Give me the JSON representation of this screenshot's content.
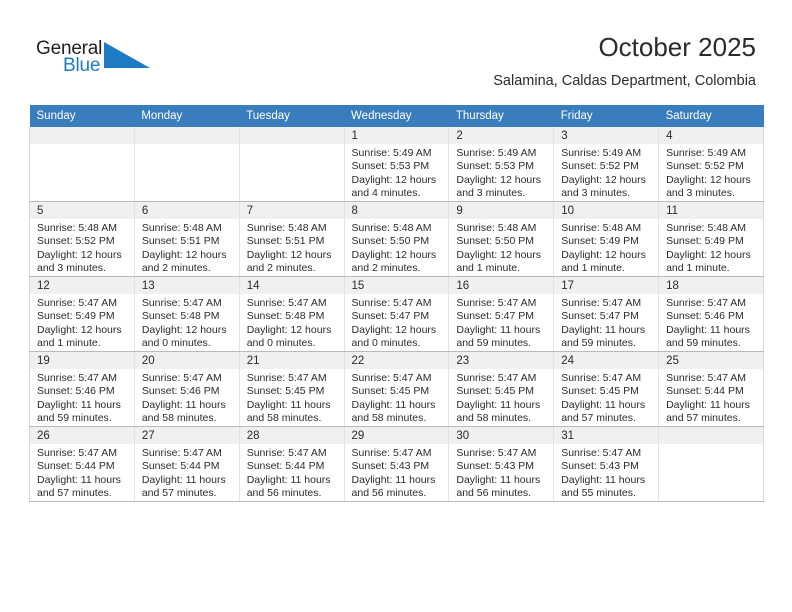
{
  "brand": {
    "name_part1": "General",
    "name_part2": "Blue",
    "triangle_icon": "triangle-icon",
    "accent_color": "#1f7ac4"
  },
  "header": {
    "title": "October 2025",
    "subtitle": "Salamina, Caldas Department, Colombia"
  },
  "calendar": {
    "header_bg": "#3a7dbf",
    "daynum_bg": "#f0f0f0",
    "columns": [
      "Sunday",
      "Monday",
      "Tuesday",
      "Wednesday",
      "Thursday",
      "Friday",
      "Saturday"
    ],
    "weeks": [
      [
        {
          "day": "",
          "lines": []
        },
        {
          "day": "",
          "lines": []
        },
        {
          "day": "",
          "lines": []
        },
        {
          "day": "1",
          "lines": [
            "Sunrise: 5:49 AM",
            "Sunset: 5:53 PM",
            "Daylight: 12 hours",
            "and 4 minutes."
          ]
        },
        {
          "day": "2",
          "lines": [
            "Sunrise: 5:49 AM",
            "Sunset: 5:53 PM",
            "Daylight: 12 hours",
            "and 3 minutes."
          ]
        },
        {
          "day": "3",
          "lines": [
            "Sunrise: 5:49 AM",
            "Sunset: 5:52 PM",
            "Daylight: 12 hours",
            "and 3 minutes."
          ]
        },
        {
          "day": "4",
          "lines": [
            "Sunrise: 5:49 AM",
            "Sunset: 5:52 PM",
            "Daylight: 12 hours",
            "and 3 minutes."
          ]
        }
      ],
      [
        {
          "day": "5",
          "lines": [
            "Sunrise: 5:48 AM",
            "Sunset: 5:52 PM",
            "Daylight: 12 hours",
            "and 3 minutes."
          ]
        },
        {
          "day": "6",
          "lines": [
            "Sunrise: 5:48 AM",
            "Sunset: 5:51 PM",
            "Daylight: 12 hours",
            "and 2 minutes."
          ]
        },
        {
          "day": "7",
          "lines": [
            "Sunrise: 5:48 AM",
            "Sunset: 5:51 PM",
            "Daylight: 12 hours",
            "and 2 minutes."
          ]
        },
        {
          "day": "8",
          "lines": [
            "Sunrise: 5:48 AM",
            "Sunset: 5:50 PM",
            "Daylight: 12 hours",
            "and 2 minutes."
          ]
        },
        {
          "day": "9",
          "lines": [
            "Sunrise: 5:48 AM",
            "Sunset: 5:50 PM",
            "Daylight: 12 hours",
            "and 1 minute."
          ]
        },
        {
          "day": "10",
          "lines": [
            "Sunrise: 5:48 AM",
            "Sunset: 5:49 PM",
            "Daylight: 12 hours",
            "and 1 minute."
          ]
        },
        {
          "day": "11",
          "lines": [
            "Sunrise: 5:48 AM",
            "Sunset: 5:49 PM",
            "Daylight: 12 hours",
            "and 1 minute."
          ]
        }
      ],
      [
        {
          "day": "12",
          "lines": [
            "Sunrise: 5:47 AM",
            "Sunset: 5:49 PM",
            "Daylight: 12 hours",
            "and 1 minute."
          ]
        },
        {
          "day": "13",
          "lines": [
            "Sunrise: 5:47 AM",
            "Sunset: 5:48 PM",
            "Daylight: 12 hours",
            "and 0 minutes."
          ]
        },
        {
          "day": "14",
          "lines": [
            "Sunrise: 5:47 AM",
            "Sunset: 5:48 PM",
            "Daylight: 12 hours",
            "and 0 minutes."
          ]
        },
        {
          "day": "15",
          "lines": [
            "Sunrise: 5:47 AM",
            "Sunset: 5:47 PM",
            "Daylight: 12 hours",
            "and 0 minutes."
          ]
        },
        {
          "day": "16",
          "lines": [
            "Sunrise: 5:47 AM",
            "Sunset: 5:47 PM",
            "Daylight: 11 hours",
            "and 59 minutes."
          ]
        },
        {
          "day": "17",
          "lines": [
            "Sunrise: 5:47 AM",
            "Sunset: 5:47 PM",
            "Daylight: 11 hours",
            "and 59 minutes."
          ]
        },
        {
          "day": "18",
          "lines": [
            "Sunrise: 5:47 AM",
            "Sunset: 5:46 PM",
            "Daylight: 11 hours",
            "and 59 minutes."
          ]
        }
      ],
      [
        {
          "day": "19",
          "lines": [
            "Sunrise: 5:47 AM",
            "Sunset: 5:46 PM",
            "Daylight: 11 hours",
            "and 59 minutes."
          ]
        },
        {
          "day": "20",
          "lines": [
            "Sunrise: 5:47 AM",
            "Sunset: 5:46 PM",
            "Daylight: 11 hours",
            "and 58 minutes."
          ]
        },
        {
          "day": "21",
          "lines": [
            "Sunrise: 5:47 AM",
            "Sunset: 5:45 PM",
            "Daylight: 11 hours",
            "and 58 minutes."
          ]
        },
        {
          "day": "22",
          "lines": [
            "Sunrise: 5:47 AM",
            "Sunset: 5:45 PM",
            "Daylight: 11 hours",
            "and 58 minutes."
          ]
        },
        {
          "day": "23",
          "lines": [
            "Sunrise: 5:47 AM",
            "Sunset: 5:45 PM",
            "Daylight: 11 hours",
            "and 58 minutes."
          ]
        },
        {
          "day": "24",
          "lines": [
            "Sunrise: 5:47 AM",
            "Sunset: 5:45 PM",
            "Daylight: 11 hours",
            "and 57 minutes."
          ]
        },
        {
          "day": "25",
          "lines": [
            "Sunrise: 5:47 AM",
            "Sunset: 5:44 PM",
            "Daylight: 11 hours",
            "and 57 minutes."
          ]
        }
      ],
      [
        {
          "day": "26",
          "lines": [
            "Sunrise: 5:47 AM",
            "Sunset: 5:44 PM",
            "Daylight: 11 hours",
            "and 57 minutes."
          ]
        },
        {
          "day": "27",
          "lines": [
            "Sunrise: 5:47 AM",
            "Sunset: 5:44 PM",
            "Daylight: 11 hours",
            "and 57 minutes."
          ]
        },
        {
          "day": "28",
          "lines": [
            "Sunrise: 5:47 AM",
            "Sunset: 5:44 PM",
            "Daylight: 11 hours",
            "and 56 minutes."
          ]
        },
        {
          "day": "29",
          "lines": [
            "Sunrise: 5:47 AM",
            "Sunset: 5:43 PM",
            "Daylight: 11 hours",
            "and 56 minutes."
          ]
        },
        {
          "day": "30",
          "lines": [
            "Sunrise: 5:47 AM",
            "Sunset: 5:43 PM",
            "Daylight: 11 hours",
            "and 56 minutes."
          ]
        },
        {
          "day": "31",
          "lines": [
            "Sunrise: 5:47 AM",
            "Sunset: 5:43 PM",
            "Daylight: 11 hours",
            "and 55 minutes."
          ]
        },
        {
          "day": "",
          "lines": []
        }
      ]
    ]
  }
}
